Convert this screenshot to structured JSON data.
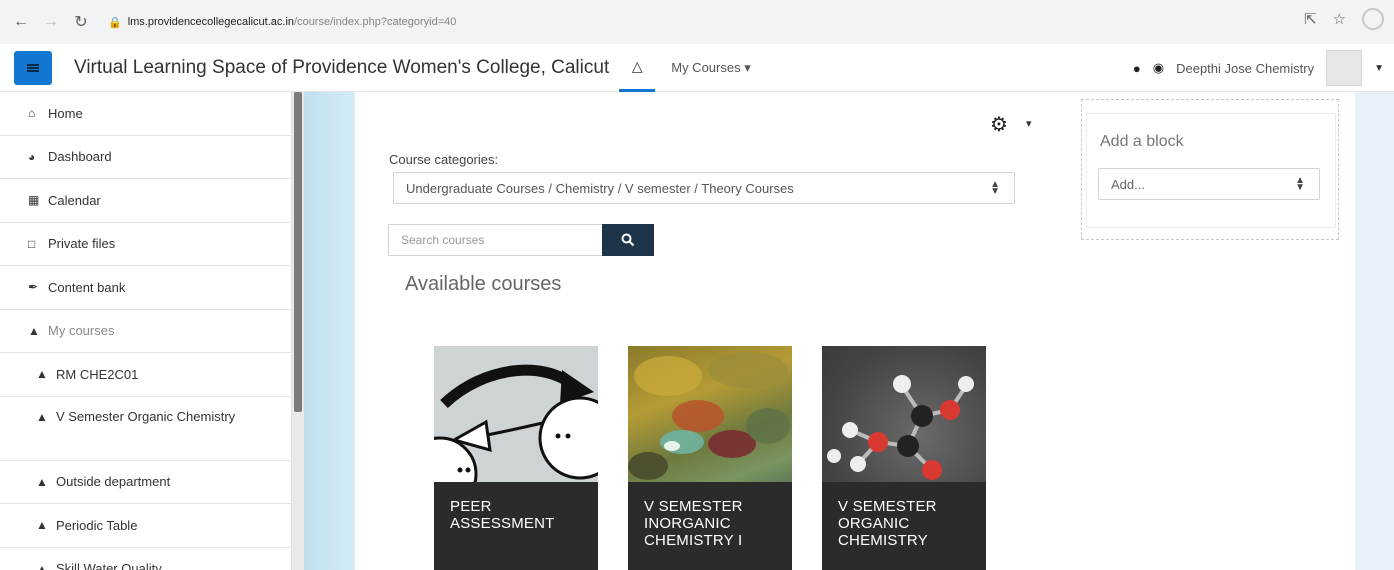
{
  "browser": {
    "url_domain": "lms.providencecollegecalicut.ac.in",
    "url_path": "/course/index.php?categoryid=40"
  },
  "navbar": {
    "site_name": "Virtual Learning Space of Providence Women's College, Calicut",
    "my_courses_label": "My Courses",
    "user_name": "Deepthi Jose Chemistry",
    "accent_color": "#1177d1"
  },
  "drawer": {
    "items": [
      {
        "label": "Home",
        "icon": "home-icon"
      },
      {
        "label": "Dashboard",
        "icon": "dashboard-icon"
      },
      {
        "label": "Calendar",
        "icon": "calendar-icon"
      },
      {
        "label": "Private files",
        "icon": "file-icon"
      },
      {
        "label": "Content bank",
        "icon": "brush-icon"
      },
      {
        "label": "My courses",
        "icon": "graduation-cap-icon"
      },
      {
        "label": "RM CHE2C01",
        "icon": "graduation-cap-icon"
      },
      {
        "label": "V Semester Organic Chemistry",
        "icon": "graduation-cap-icon"
      },
      {
        "label": "Outside department",
        "icon": "graduation-cap-icon"
      },
      {
        "label": "Periodic Table",
        "icon": "graduation-cap-icon"
      },
      {
        "label": "Skill Water Quality",
        "icon": "graduation-cap-icon"
      }
    ]
  },
  "main": {
    "category_label": "Course categories:",
    "category_value": "Undergraduate Courses / Chemistry / V semester / Theory Courses",
    "search_placeholder": "Search courses",
    "available_title": "Available courses",
    "courses": [
      {
        "title_line1": "PEER",
        "title_line2": "ASSESSMENT",
        "title_line3": ""
      },
      {
        "title_line1": "V SEMESTER",
        "title_line2": "INORGANIC",
        "title_line3": "CHEMISTRY I"
      },
      {
        "title_line1": "V SEMESTER",
        "title_line2": "ORGANIC",
        "title_line3": "CHEMISTRY"
      }
    ]
  },
  "block": {
    "title": "Add a block",
    "select_value": "Add..."
  }
}
